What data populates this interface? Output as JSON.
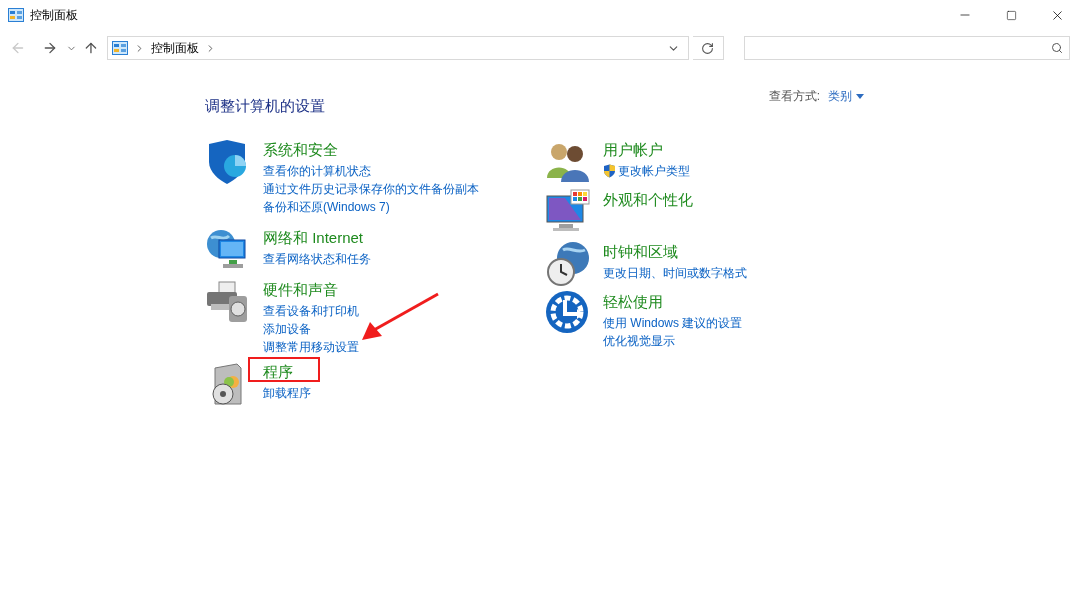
{
  "window": {
    "title": "控制面板"
  },
  "address_bar": {
    "path": [
      "控制面板"
    ]
  },
  "view_by": {
    "label": "查看方式:",
    "value": "类别"
  },
  "heading": "调整计算机的设置",
  "columns": [
    [
      {
        "title": "系统和安全",
        "highlighted": false,
        "links": [
          {
            "text": "查看你的计算机状态",
            "shield": false
          },
          {
            "text": "通过文件历史记录保存你的文件备份副本",
            "shield": false
          },
          {
            "text": "备份和还原(Windows 7)",
            "shield": false
          }
        ]
      },
      {
        "title": "网络和 Internet",
        "highlighted": false,
        "links": [
          {
            "text": "查看网络状态和任务",
            "shield": false
          }
        ]
      },
      {
        "title": "硬件和声音",
        "highlighted": false,
        "links": [
          {
            "text": "查看设备和打印机",
            "shield": false
          },
          {
            "text": "添加设备",
            "shield": false
          },
          {
            "text": "调整常用移动设置",
            "shield": false
          }
        ]
      },
      {
        "title": "程序",
        "highlighted": true,
        "links": [
          {
            "text": "卸载程序",
            "shield": false
          }
        ]
      }
    ],
    [
      {
        "title": "用户帐户",
        "highlighted": false,
        "links": [
          {
            "text": "更改帐户类型",
            "shield": true
          }
        ]
      },
      {
        "title": "外观和个性化",
        "highlighted": false
      },
      {
        "title": "时钟和区域",
        "highlighted": false,
        "links": [
          {
            "text": "更改日期、时间或数字格式",
            "shield": false
          }
        ]
      },
      {
        "title": "轻松使用",
        "highlighted": false,
        "links": [
          {
            "text": "使用 Windows 建议的设置",
            "shield": false
          },
          {
            "text": "优化视觉显示",
            "shield": false
          }
        ]
      }
    ]
  ]
}
